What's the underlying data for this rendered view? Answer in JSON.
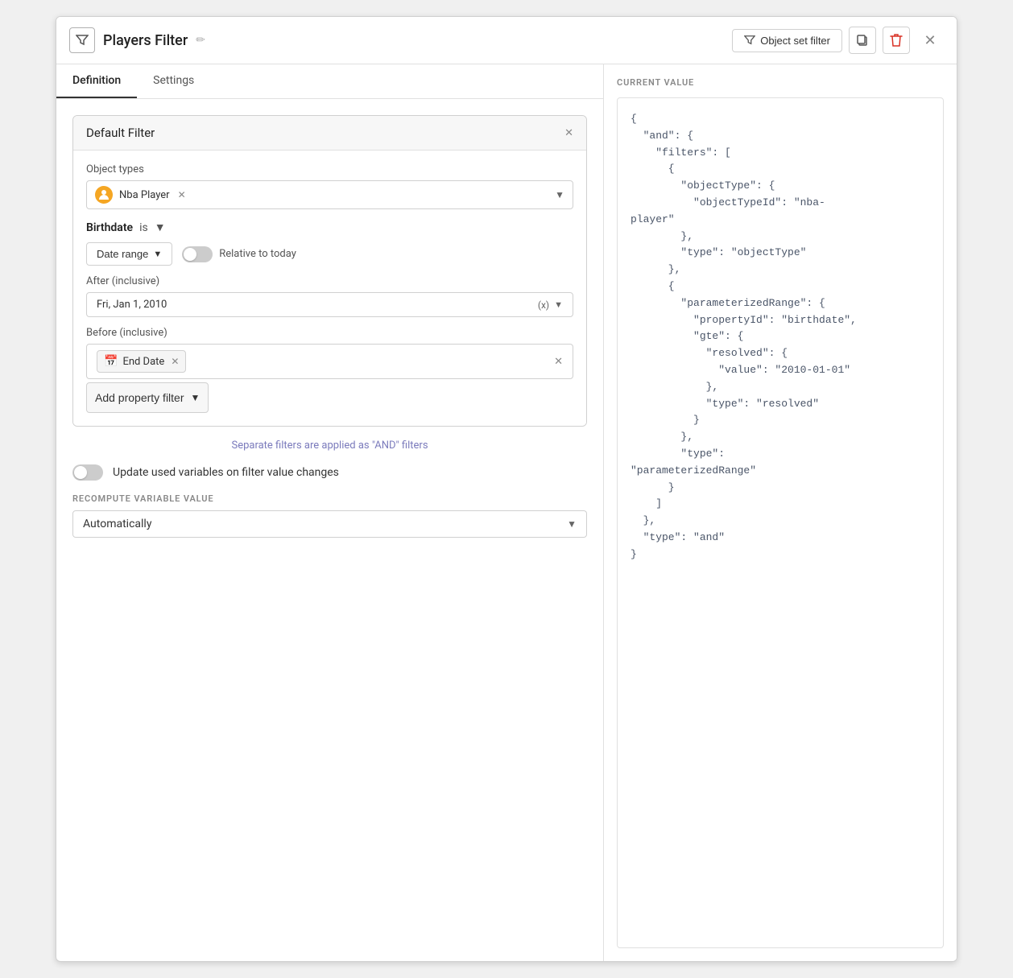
{
  "header": {
    "title": "Players Filter",
    "edit_icon": "✏",
    "object_set_filter_label": "Object set filter",
    "filter_icon": "▼",
    "copy_icon": "⧉",
    "delete_icon": "🗑",
    "close_icon": "✕"
  },
  "tabs": {
    "definition": "Definition",
    "settings": "Settings"
  },
  "filter_card": {
    "title": "Default Filter",
    "close_icon": "✕"
  },
  "object_types": {
    "label": "Object types",
    "selected_type": "Nba Player",
    "remove_icon": "✕"
  },
  "property_filter": {
    "name": "Birthdate",
    "operator": "is",
    "operator_arrow": "▼"
  },
  "date_range": {
    "label": "Date range",
    "arrow": "▼",
    "toggle_label": "Relative to today"
  },
  "after": {
    "label": "After (inclusive)",
    "value": "Fri, Jan 1, 2010",
    "suffix": "(x)",
    "arrow": "▼"
  },
  "before": {
    "label": "Before (inclusive)",
    "end_date_label": "End Date",
    "remove_icon": "✕",
    "outer_remove_icon": "✕"
  },
  "add_property_btn": {
    "label": "Add property filter",
    "arrow": "▼"
  },
  "separate_filters_note": "Separate filters are applied as \"AND\" filters",
  "update_vars": {
    "label": "Update used variables on filter value changes"
  },
  "recompute": {
    "section_label": "RECOMPUTE VARIABLE VALUE",
    "select_value": "Automatically",
    "arrow": "▼"
  },
  "current_value": {
    "section_label": "CURRENT VALUE",
    "json_content": "{\n  \"and\": {\n    \"filters\": [\n      {\n        \"objectType\": {\n          \"objectTypeId\": \"nba-\nplayer\"\n        },\n        \"type\": \"objectType\"\n      },\n      {\n        \"parameterizedRange\": {\n          \"propertyId\": \"birthdate\",\n          \"gte\": {\n            \"resolved\": {\n              \"value\": \"2010-01-01\"\n            },\n            \"type\": \"resolved\"\n          }\n        },\n        \"type\":\n\"parameterizedRange\"\n      }\n    ]\n  },\n  \"type\": \"and\"\n}"
  },
  "icons": {
    "funnel": "⛾",
    "calendar": "📅",
    "person": "👤"
  }
}
